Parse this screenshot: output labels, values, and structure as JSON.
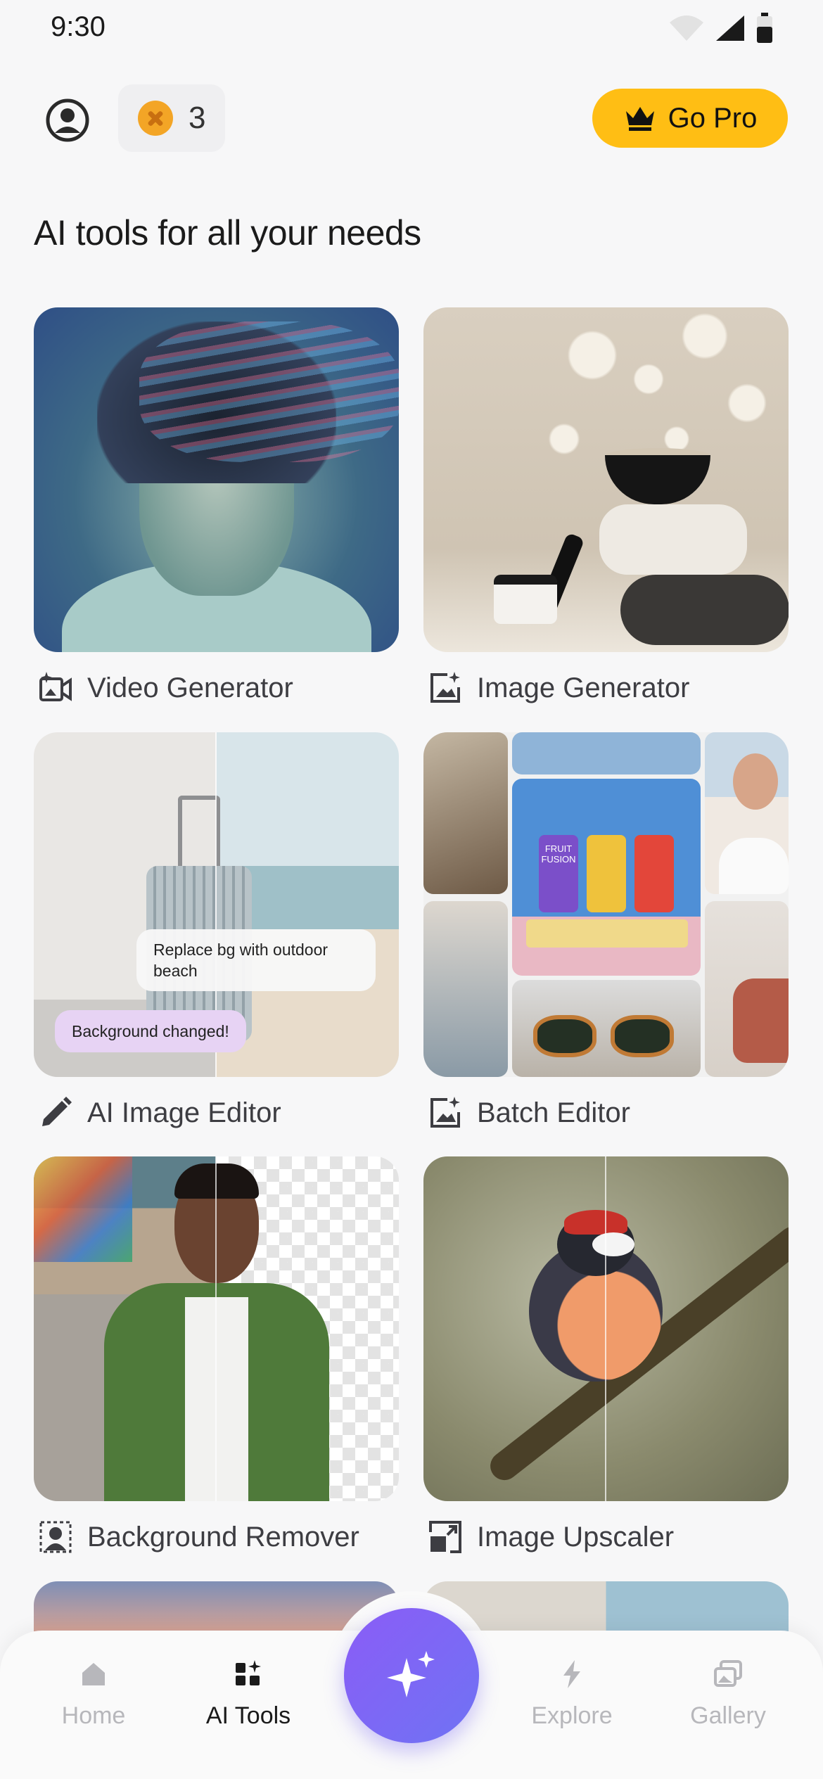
{
  "status_bar": {
    "time": "9:30"
  },
  "header": {
    "credits": "3",
    "go_pro_label": "Go Pro",
    "colors": {
      "go_pro_bg": "#ffbe14",
      "coin": "#f3a526"
    }
  },
  "section_title": "AI tools for all your needs",
  "tools": [
    {
      "label": "Video Generator",
      "icon": "video-sparkle-icon"
    },
    {
      "label": "Image Generator",
      "icon": "image-sparkle-icon"
    },
    {
      "label": "AI Image Editor",
      "icon": "pencil-icon",
      "prompt_bubble": "Replace bg with outdoor beach",
      "reply_bubble": "Background changed!"
    },
    {
      "label": "Batch Editor",
      "icon": "image-sparkle-icon",
      "can_text": "FRUIT FUSION"
    },
    {
      "label": "Background Remover",
      "icon": "person-remove-bg-icon"
    },
    {
      "label": "Image Upscaler",
      "icon": "upscale-icon"
    }
  ],
  "bottom_nav": {
    "items": [
      {
        "label": "Home",
        "icon": "home-icon",
        "active": false
      },
      {
        "label": "AI Tools",
        "icon": "grid-sparkle-icon",
        "active": true
      },
      {
        "label": "Explore",
        "icon": "lightning-icon",
        "active": false
      },
      {
        "label": "Gallery",
        "icon": "gallery-icon",
        "active": false
      }
    ],
    "fab_icon": "sparkle-icon",
    "colors": {
      "fab_start": "#8b5cf6",
      "fab_end": "#6f73f4"
    }
  }
}
